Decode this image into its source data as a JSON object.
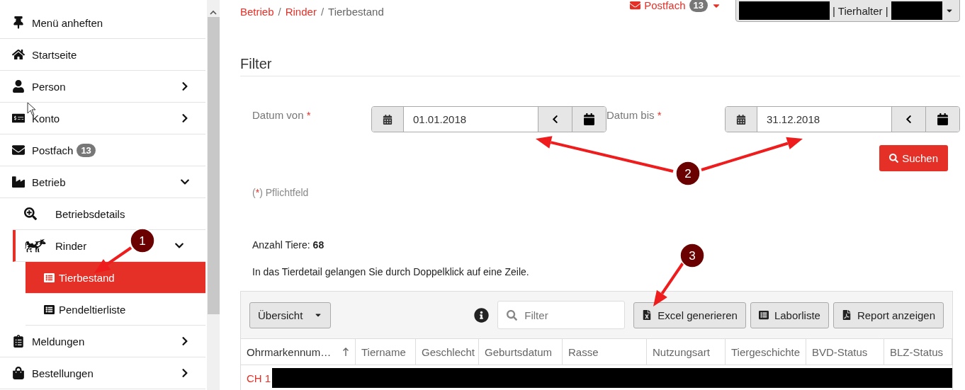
{
  "sidebar": {
    "items": [
      {
        "label": "Menü anheften"
      },
      {
        "label": "Startseite"
      },
      {
        "label": "Person",
        "expanded": false
      },
      {
        "label": "Konto",
        "expanded": false
      },
      {
        "label": "Postfach",
        "badge": "13"
      },
      {
        "label": "Betrieb",
        "expanded": true,
        "children": [
          {
            "label": "Betriebsdetails",
            "active": false
          },
          {
            "label": "Rinder",
            "active": true,
            "expanded": true,
            "children": [
              {
                "label": "Tierbestand",
                "selected": true
              },
              {
                "label": "Pendeltierliste",
                "selected": false
              }
            ]
          }
        ]
      },
      {
        "label": "Meldungen",
        "expanded": false
      },
      {
        "label": "Bestellungen",
        "expanded": false
      }
    ]
  },
  "breadcrumb": [
    {
      "label": "Betrieb",
      "link": true,
      "separator": "/"
    },
    {
      "label": "Rinder",
      "link": true,
      "separator": "/"
    },
    {
      "label": "Tierbestand",
      "link": false
    }
  ],
  "mailbox": {
    "label": "Postfach",
    "badge": "13"
  },
  "user_menu": {
    "role": "| Tierhalter |"
  },
  "filter": {
    "title": "Filter",
    "dates": [
      {
        "label": "Datum von",
        "required_mark": "*",
        "value": "01.01.2018"
      },
      {
        "label": "Datum bis",
        "required_mark": "*",
        "value": "31.12.2018"
      }
    ],
    "search_button": "Suchen",
    "legend": {
      "open": "(",
      "mark": "*",
      "rest": ") Pflichtfeld"
    }
  },
  "count": "Anzahl Tiere: **68**",
  "hint": "In das Tierdetail gelangen Sie durch Doppelklick auf eine Zeile.",
  "toolbar": {
    "view_select": "Übersicht",
    "search": {
      "placeholder": "Filter"
    },
    "buttons": [
      "Excel generieren",
      "Laborliste",
      "Report anzeigen"
    ]
  },
  "table": {
    "columns": [
      {
        "label": "Ohrmarkennum…",
        "sorted": true
      },
      {
        "label": "Tiername",
        "sorted": false
      },
      {
        "label": "Geschlecht",
        "sorted": false
      },
      {
        "label": "Geburtsdatum",
        "sorted": false
      },
      {
        "label": "Rasse",
        "sorted": false
      },
      {
        "label": "Nutzungsart",
        "sorted": false
      },
      {
        "label": "Tiergeschichte",
        "sorted": false
      },
      {
        "label": "BVD-Status",
        "sorted": false
      },
      {
        "label": "BLZ-Status",
        "sorted": false
      }
    ],
    "rows": [
      {
        "ear_tag": "CH 1"
      }
    ]
  },
  "annotations": [
    "1",
    "2",
    "3"
  ]
}
